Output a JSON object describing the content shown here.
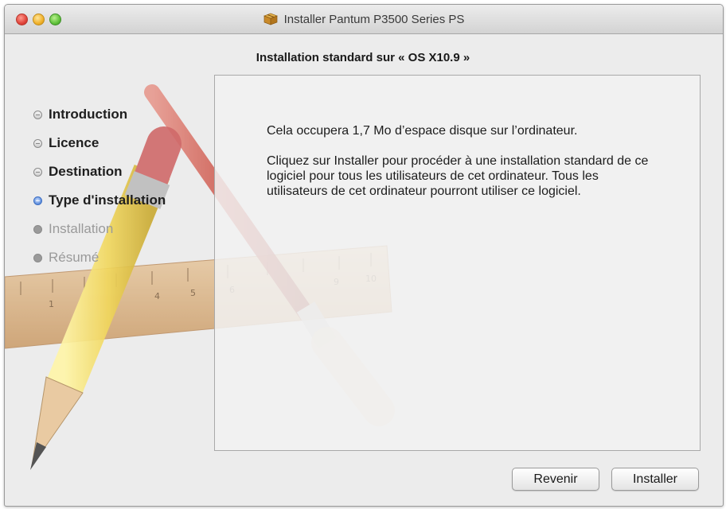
{
  "window": {
    "title": "Installer Pantum P3500 Series PS"
  },
  "heading": "Installation standard sur « OS X10.9 »",
  "sidebar": {
    "steps": [
      {
        "label": "Introduction",
        "state": "done"
      },
      {
        "label": "Licence",
        "state": "done"
      },
      {
        "label": "Destination",
        "state": "done"
      },
      {
        "label": "Type d'installation",
        "state": "current"
      },
      {
        "label": "Installation",
        "state": "future"
      },
      {
        "label": "Résumé",
        "state": "future"
      }
    ]
  },
  "content": {
    "paragraph1": "Cela occupera 1,7 Mo d’espace disque sur l’ordinateur.",
    "paragraph2": "Cliquez sur Installer pour procéder à une installation standard de ce logiciel pour tous les utilisateurs de cet ordinateur. Tous les utilisateurs de cet ordinateur pourront utiliser ce logiciel."
  },
  "buttons": {
    "back": "Revenir",
    "install": "Installer"
  },
  "background_art": {
    "ruler_ticks": [
      "1",
      "4",
      "5",
      "6",
      "9",
      "10"
    ]
  },
  "icons": [
    "close-icon",
    "minimize-icon",
    "zoom-icon",
    "package-icon",
    "pencil-illustration",
    "brush-illustration",
    "ruler-illustration"
  ],
  "colors": {
    "window_bg": "#ececec",
    "current_step_bullet": "#4a7fd4",
    "future_step_text": "#9a9a9a"
  }
}
